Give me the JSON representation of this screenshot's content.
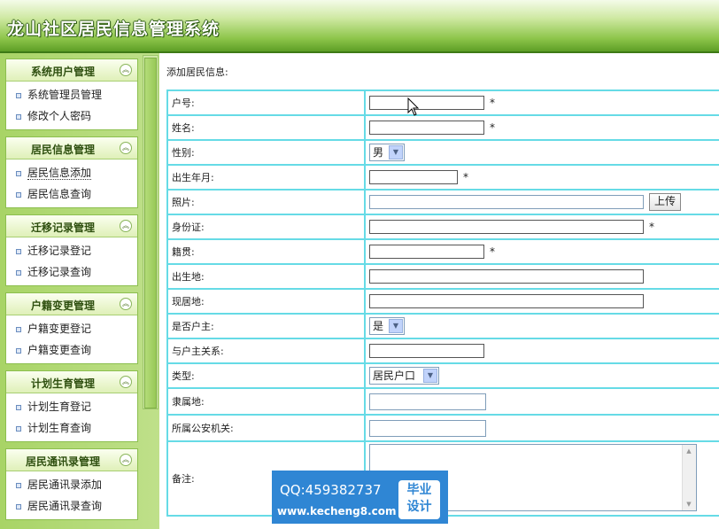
{
  "header": {
    "title": "龙山社区居民信息管理系统"
  },
  "sidebar": {
    "panels": [
      {
        "title": "系统用户管理",
        "items": [
          "系统管理员管理",
          "修改个人密码"
        ]
      },
      {
        "title": "居民信息管理",
        "items": [
          "居民信息添加",
          "居民信息查询"
        ]
      },
      {
        "title": "迁移记录管理",
        "items": [
          "迁移记录登记",
          "迁移记录查询"
        ]
      },
      {
        "title": "户籍变更管理",
        "items": [
          "户籍变更登记",
          "户籍变更查询"
        ]
      },
      {
        "title": "计划生育管理",
        "items": [
          "计划生育登记",
          "计划生育查询"
        ]
      },
      {
        "title": "居民通讯录管理",
        "items": [
          "居民通讯录添加",
          "居民通讯录查询"
        ]
      }
    ],
    "collapse_icon": "double-chevron-up-icon"
  },
  "main": {
    "heading": "添加居民信息:",
    "required_mark": "*",
    "fields": {
      "hukou_no": {
        "label": "户号:",
        "value": ""
      },
      "name": {
        "label": "姓名:",
        "value": ""
      },
      "gender": {
        "label": "性别:",
        "value": "男"
      },
      "birth": {
        "label": "出生年月:",
        "value": ""
      },
      "photo": {
        "label": "照片:",
        "value": "",
        "upload": "上传"
      },
      "id_card": {
        "label": "身份证:",
        "value": ""
      },
      "native": {
        "label": "籍贯:",
        "value": ""
      },
      "birthplace": {
        "label": "出生地:",
        "value": ""
      },
      "residence": {
        "label": "现居地:",
        "value": ""
      },
      "is_head": {
        "label": "是否户主:",
        "value": "是"
      },
      "relation": {
        "label": "与户主关系:",
        "value": ""
      },
      "type": {
        "label": "类型:",
        "value": "居民户口"
      },
      "belong": {
        "label": "隶属地:",
        "value": ""
      },
      "police": {
        "label": "所属公安机关:",
        "value": ""
      },
      "remark": {
        "label": "备注:",
        "value": ""
      }
    }
  },
  "watermark": {
    "qq": "QQ:459382737",
    "url": "www.kecheng8.com",
    "badge_line1": "毕业",
    "badge_line2": "设计",
    "color": "#2f86d4"
  }
}
